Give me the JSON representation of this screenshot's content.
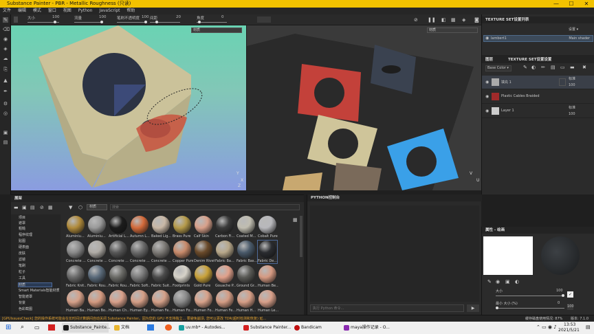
{
  "window": {
    "title": "Substance Painter - PBR - Metallic Roughness (只读)",
    "minimize": "—",
    "maximize": "☐",
    "close": "✕"
  },
  "menu": [
    "文件",
    "编辑",
    "模式",
    "窗口",
    "视图",
    "Python",
    "JavaScript",
    "帮助"
  ],
  "tool_options": {
    "size_label": "大小",
    "size_value": "100",
    "flow_label": "流量",
    "flow_value": "100",
    "stroke_opacity_label": "笔刷不透明度",
    "stroke_opacity_value": "100",
    "spacing_label": "间距",
    "spacing_value": "20",
    "angle_label": "角度",
    "angle_value": "0"
  },
  "viewport3d": {
    "dropdown": "材质",
    "axis_y": "Y",
    "axis_x": "X",
    "axis_z": "Z"
  },
  "viewport2d": {
    "dropdown": "材质",
    "axis_v": "V",
    "axis_u": "U"
  },
  "texture_set_list": {
    "title": "TEXTURE SET设置列表",
    "settings": "设置 ▾",
    "item": "lambert1",
    "shader": "Main shader"
  },
  "layers": {
    "tab_layers": "图层",
    "tab_settings": "TEXTURE SET设置设置",
    "blend_mode": "Base Color ▾",
    "items": [
      {
        "name": "填充 1",
        "blend": "标准",
        "opacity": "100"
      },
      {
        "name": "Plastic Cables Braided",
        "blend": "",
        "opacity": ""
      },
      {
        "name": "Layer 1",
        "blend": "标准",
        "opacity": "100"
      }
    ]
  },
  "shelf": {
    "title": "展架",
    "search_tag": "材质",
    "search_placeholder": "搜索",
    "categories": [
      "项目",
      "遮罩",
      "粗糙",
      "程序纹理",
      "贴图",
      "硬表面",
      "皮肤",
      "滤镜",
      "笔刷",
      "粒子",
      "工具",
      "材质",
      "Smart Materials智能材质",
      "智能遮罩",
      "背景",
      "色彩截图"
    ],
    "selected_category": "材质",
    "materials": [
      {
        "label": "Aluminiu...",
        "color": "#b08a3a"
      },
      {
        "label": "Aluminiu...",
        "color": "#9a9a9a"
      },
      {
        "label": "Artificial L...",
        "color": "#1c1c1c"
      },
      {
        "label": "Autumn L...",
        "color": "#d36a3a"
      },
      {
        "label": "Baked Lig...",
        "color": "#c9b8a6"
      },
      {
        "label": "Brass Pure",
        "color": "#b59a4a"
      },
      {
        "label": "Calf Skin",
        "color": "#d8a08a"
      },
      {
        "label": "Carbon Fi...",
        "color": "#3a3a3a"
      },
      {
        "label": "Coated M...",
        "color": "#c0bdb0"
      },
      {
        "label": "Cobalt Pure",
        "color": "#b8b8bc"
      },
      {
        "label": "Concrete ...",
        "color": "#8a8a8a"
      },
      {
        "label": "Concrete ...",
        "color": "#b0aca6"
      },
      {
        "label": "Concrete ...",
        "color": "#585858"
      },
      {
        "label": "Concrete ...",
        "color": "#6a6a6a"
      },
      {
        "label": "Concrete ...",
        "color": "#7d7a76"
      },
      {
        "label": "Copper Pure",
        "color": "#c88a6a"
      },
      {
        "label": "Denim Rivet",
        "color": "#6a4a2a"
      },
      {
        "label": "Fabric Ba...",
        "color": "#b8a88a"
      },
      {
        "label": "Fabric Bas...",
        "color": "#4a5a6a"
      },
      {
        "label": "Fabric De...",
        "color": "#2a2c30"
      },
      {
        "label": "Fabric Knit...",
        "color": "#6a6a6a"
      },
      {
        "label": "Fabric Rou...",
        "color": "#5a6a7a"
      },
      {
        "label": "Fabric Rou...",
        "color": "#6a6a66"
      },
      {
        "label": "Fabric Soft...",
        "color": "#7a7a7a"
      },
      {
        "label": "Fabric Suit...",
        "color": "#4a4a4a"
      },
      {
        "label": "Footprints",
        "color": "#d6d2c8"
      },
      {
        "label": "Gold Pure",
        "color": "#c9a23a"
      },
      {
        "label": "Gouache P...",
        "color": "#e0a08a"
      },
      {
        "label": "Ground Gr...",
        "color": "#5a5a56"
      },
      {
        "label": "Human Be...",
        "color": "#d69a82"
      },
      {
        "label": "Human Ba...",
        "color": "#d6a088"
      },
      {
        "label": "Human Bo...",
        "color": "#d49a80"
      },
      {
        "label": "Human Ch...",
        "color": "#d8a08a"
      },
      {
        "label": "Human Ey...",
        "color": "#d49e86"
      },
      {
        "label": "Human Fe...",
        "color": "#d4a088"
      },
      {
        "label": "Human Fo...",
        "color": "#8a8a8a"
      },
      {
        "label": "Human Fo...",
        "color": "#d8a28a"
      },
      {
        "label": "Human Fe...",
        "color": "#d49c84"
      },
      {
        "label": "Human H...",
        "color": "#d69e86"
      },
      {
        "label": "Human Le...",
        "color": "#d8a08a"
      }
    ]
  },
  "python_console": {
    "title": "PYTHON控制台",
    "input_placeholder": "执行 Python 命令...",
    "run": "▶"
  },
  "properties": {
    "title": "属性 - 绘画",
    "size_label": "大小",
    "size_value": "100",
    "min_size_label": "最小 大小 (%)",
    "min_size_value": "0",
    "mode": "100"
  },
  "status": {
    "message": "[GPUIssuesCheck] 您的操作系统可能会在长时间计算期间自动关闭 Substance Painter。因为您的 GPU 不支持独立... 要避免崩溃, 您可以更改 TDR(超时检测和恢复) 延...",
    "cache": "缓存磁盘使用情况: 87%",
    "version": "版本: 7.1.0"
  },
  "taskbar": {
    "apps": [
      "Substance_Painte...",
      "文档",
      "uv.mb* - Autodes...",
      "Substance Painter...",
      "Bandicam",
      "maya操作记录 - O..."
    ],
    "time": "13:53",
    "date": "2021/5/21"
  }
}
